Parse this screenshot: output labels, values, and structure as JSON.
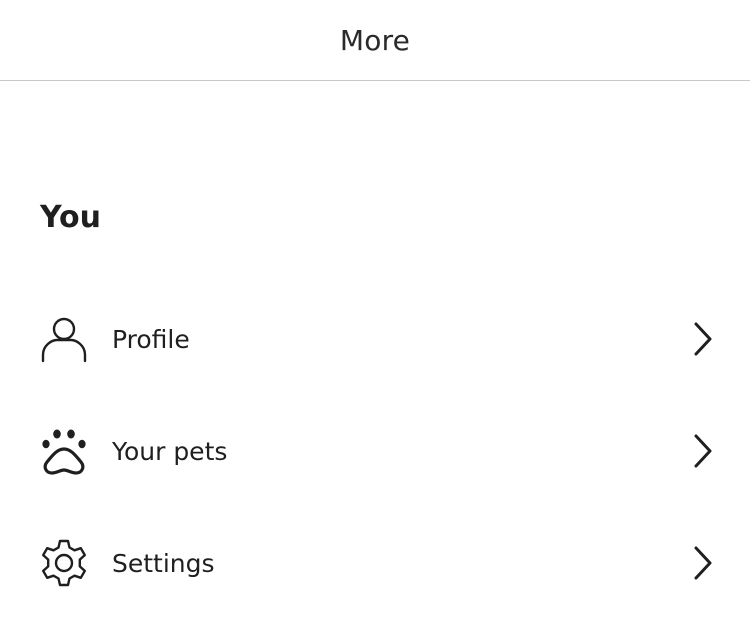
{
  "header": {
    "title": "More"
  },
  "section": {
    "heading": "You"
  },
  "menu": {
    "items": [
      {
        "label": "Profile",
        "icon": "person-icon"
      },
      {
        "label": "Your pets",
        "icon": "paw-icon"
      },
      {
        "label": "Settings",
        "icon": "gear-icon"
      }
    ]
  }
}
